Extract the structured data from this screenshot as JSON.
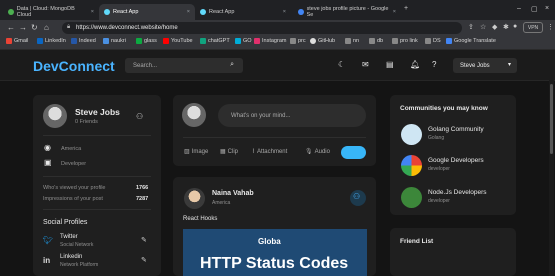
{
  "browser": {
    "tabs": [
      {
        "label": "Data | Cloud: MongoDB Cloud",
        "active": false
      },
      {
        "label": "React App",
        "active": true
      },
      {
        "label": "React App",
        "active": false
      },
      {
        "label": "steve jobs profile picture - Google Se",
        "active": false
      }
    ],
    "url": "https://www.devconnect.website/home",
    "vpn_label": "VPN",
    "bookmarks": [
      "Gmail",
      "LinkedIn",
      "Indeed",
      "naukri",
      "glass",
      "YouTube",
      "chatGPT",
      "GO",
      "Instagram",
      "prc",
      "GitHub",
      "nn",
      "db",
      "pro link",
      "DS",
      "Google Translate"
    ]
  },
  "app": {
    "logo": "DevConnect",
    "search_placeholder": "Search...",
    "user_name": "Steve Jobs",
    "colors": {
      "accent": "#4ab4ff",
      "bg": "#141414",
      "card": "#1f1f1f"
    }
  },
  "profile": {
    "name": "Steve Jobs",
    "friends": "0 Friends",
    "location": "America",
    "occupation": "Developer",
    "viewed_label": "Who's viewed your profile",
    "viewed_count": "1766",
    "impressions_label": "Impressions of your post",
    "impressions_count": "7287",
    "social_title": "Social Profiles",
    "socials": [
      {
        "name": "Twitter",
        "sub": "Social Network"
      },
      {
        "name": "Linkedin",
        "sub": "Network Platform"
      }
    ]
  },
  "composer": {
    "placeholder": "What's on your mind...",
    "options": [
      "Image",
      "Clip",
      "Attachment",
      "Audio"
    ]
  },
  "post": {
    "author": "Naina Vahab",
    "location": "America",
    "caption": "React Hooks",
    "banner_brand": "Globa",
    "banner_title": "HTTP Status Codes"
  },
  "communities": {
    "title": "Communities you may know",
    "items": [
      {
        "name": "Golang Community",
        "sub": "Golang"
      },
      {
        "name": "Google Developers",
        "sub": "developer"
      },
      {
        "name": "Node.Js Developers",
        "sub": "developer"
      }
    ]
  },
  "friends": {
    "title": "Friend List"
  }
}
